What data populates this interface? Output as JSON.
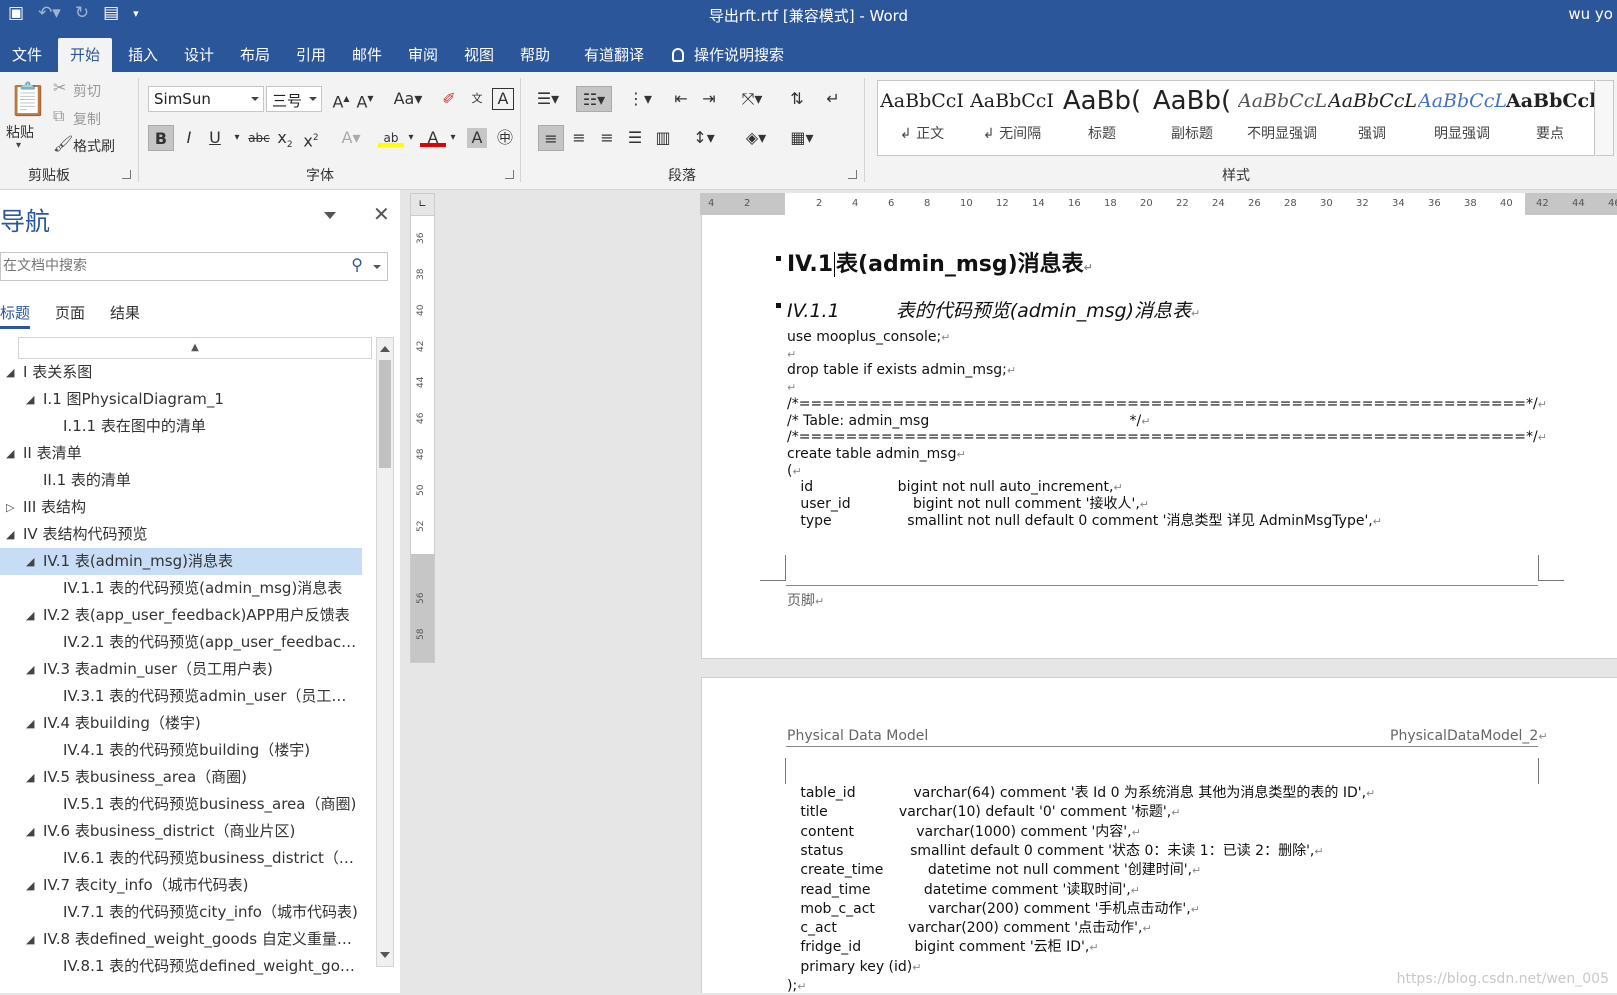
{
  "titlebar": {
    "title": "导出rft.rtf [兼容模式]  -  Word",
    "user": "wu yo"
  },
  "tabs": [
    "文件",
    "开始",
    "插入",
    "设计",
    "布局",
    "引用",
    "邮件",
    "审阅",
    "视图",
    "帮助",
    "有道翻译",
    "操作说明搜索"
  ],
  "ribbon": {
    "clipboard": {
      "paste": "粘贴",
      "cut": "剪切",
      "copy": "复制",
      "format_painter": "格式刷",
      "group": "剪贴板"
    },
    "font": {
      "name": "SimSun",
      "size": "三号",
      "group": "字体"
    },
    "paragraph": {
      "group": "段落"
    },
    "styles": {
      "group": "样式",
      "items": [
        {
          "preview": "AaBbCcI",
          "name": "↲ 正文"
        },
        {
          "preview": "AaBbCcI",
          "name": "↲ 无间隔"
        },
        {
          "preview": "AaBb(",
          "name": "标题"
        },
        {
          "preview": "AaBb(",
          "name": "副标题"
        },
        {
          "preview": "AaBbCcL",
          "name": "不明显强调"
        },
        {
          "preview": "AaBbCcL",
          "name": "强调"
        },
        {
          "preview": "AaBbCcL",
          "name": "明显强调"
        },
        {
          "preview": "AaBbCcl",
          "name": "要点"
        }
      ]
    }
  },
  "nav": {
    "title": "导航",
    "search_placeholder": "在文档中搜索",
    "tabs": [
      "标题",
      "页面",
      "结果"
    ],
    "items": [
      {
        "label": "I 表关系图",
        "level": 0,
        "twisty": "◢"
      },
      {
        "label": "I.1 图PhysicalDiagram_1",
        "level": 1,
        "twisty": "◢"
      },
      {
        "label": "I.1.1 表在图中的清单",
        "level": 2,
        "twisty": ""
      },
      {
        "label": "II 表清单",
        "level": 0,
        "twisty": "◢"
      },
      {
        "label": "II.1 表的清单",
        "level": 1,
        "twisty": ""
      },
      {
        "label": "III 表结构",
        "level": 0,
        "twisty": "▷"
      },
      {
        "label": "IV 表结构代码预览",
        "level": 0,
        "twisty": "◢"
      },
      {
        "label": "IV.1 表(admin_msg)消息表",
        "level": 1,
        "twisty": "◢",
        "selected": true
      },
      {
        "label": "IV.1.1 表的代码预览(admin_msg)消息表",
        "level": 2,
        "twisty": ""
      },
      {
        "label": "IV.2 表(app_user_feedback)APP用户反馈表",
        "level": 1,
        "twisty": "◢"
      },
      {
        "label": "IV.2.1 表的代码预览(app_user_feedback)...",
        "level": 2,
        "twisty": ""
      },
      {
        "label": "IV.3 表admin_user（员工用户表)",
        "level": 1,
        "twisty": "◢"
      },
      {
        "label": "IV.3.1 表的代码预览admin_user（员工用户...",
        "level": 2,
        "twisty": ""
      },
      {
        "label": "IV.4 表building（楼宇)",
        "level": 1,
        "twisty": "◢"
      },
      {
        "label": "IV.4.1 表的代码预览building（楼宇)",
        "level": 2,
        "twisty": ""
      },
      {
        "label": "IV.5 表business_area（商圈)",
        "level": 1,
        "twisty": "◢"
      },
      {
        "label": "IV.5.1 表的代码预览business_area（商圈)",
        "level": 2,
        "twisty": ""
      },
      {
        "label": "IV.6 表business_district（商业片区)",
        "level": 1,
        "twisty": "◢"
      },
      {
        "label": "IV.6.1 表的代码预览business_district（商...",
        "level": 2,
        "twisty": ""
      },
      {
        "label": "IV.7 表city_info（城市代码表)",
        "level": 1,
        "twisty": "◢"
      },
      {
        "label": "IV.7.1 表的代码预览city_info（城市代码表)",
        "level": 2,
        "twisty": ""
      },
      {
        "label": "IV.8 表defined_weight_goods 自定义重量商...",
        "level": 1,
        "twisty": "◢"
      },
      {
        "label": "IV.8.1 表的代码预览defined_weight_good...",
        "level": 2,
        "twisty": ""
      }
    ]
  },
  "ruler": {
    "h": [
      "4",
      "2",
      "",
      "2",
      "4",
      "6",
      "8",
      "10",
      "12",
      "14",
      "16",
      "18",
      "20",
      "22",
      "24",
      "26",
      "28",
      "30",
      "32",
      "34",
      "36",
      "38",
      "40",
      "42",
      "44",
      "46"
    ],
    "v": [
      "36",
      "38",
      "40",
      "42",
      "44",
      "46",
      "48",
      "50",
      "52",
      "",
      "56",
      "58",
      ""
    ]
  },
  "doc": {
    "h1": "IV.1",
    "h1_rest": "表(admin_msg)消息表",
    "h2_num": "IV.1.1",
    "h2_text": "表的代码预览(admin_msg)消息表",
    "page1_lines": [
      "use mooplus_console;",
      "",
      "drop table if exists admin_msg;",
      "",
      "/*==============================================================*/",
      "/* Table: admin_msg                                             */",
      "/*==============================================================*/",
      "create table admin_msg",
      "(",
      "   id                   bigint not null auto_increment,",
      "   user_id              bigint not null comment '接收人',",
      "   type                 smallint not null default 0 comment '消息类型 详见 AdminMsgType',"
    ],
    "footer": "页脚",
    "header_left": "Physical Data Model",
    "header_right": "PhysicalDataModel_2",
    "page2_lines": [
      "   table_id             varchar(64) comment '表 Id 0 为系统消息 其他为消息类型的表的 ID',",
      "   title                varchar(10) default '0' comment '标题',",
      "   content              varchar(1000) comment '内容',",
      "   status               smallint default 0 comment '状态 0：未读 1：已读 2：删除',",
      "   create_time          datetime not null comment '创建时间',",
      "   read_time            datetime comment '读取时间',",
      "   mob_c_act            varchar(200) comment '手机点击动作',",
      "   c_act                varchar(200) comment '点击动作',",
      "   fridge_id            bigint comment '云柜 ID',",
      "   primary key (id)",
      ");"
    ]
  },
  "watermark": "https://blog.csdn.net/wen_005"
}
